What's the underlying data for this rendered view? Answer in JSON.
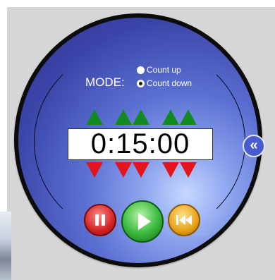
{
  "mode": {
    "label": "MODE:",
    "options": [
      {
        "label": "Count up",
        "checked": false
      },
      {
        "label": "Count down",
        "checked": true
      }
    ]
  },
  "display": {
    "value": "0:15:00"
  },
  "controls": {
    "pause_icon": "pause-icon",
    "play_icon": "play-icon",
    "reset_icon": "rewind-to-start-icon",
    "collapse_glyph": "«"
  },
  "colors": {
    "face_outer": "#0c0c0c",
    "face_blue": "#3b45a8",
    "up_arrow": "#128a22",
    "down_arrow": "#e3141c",
    "pause": "#d12424",
    "play": "#3ab83d",
    "reset": "#e8a21a"
  }
}
